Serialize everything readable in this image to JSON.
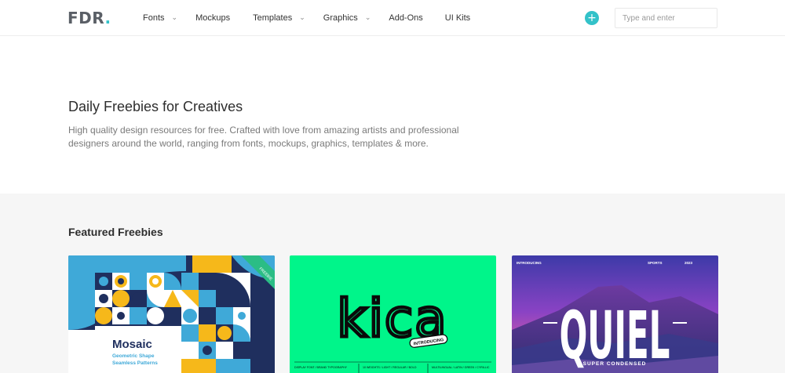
{
  "header": {
    "logo_text": "FDR",
    "logo_dot": ".",
    "nav": [
      {
        "label": "Fonts",
        "has_dropdown": true
      },
      {
        "label": "Mockups",
        "has_dropdown": false
      },
      {
        "label": "Templates",
        "has_dropdown": true
      },
      {
        "label": "Graphics",
        "has_dropdown": true
      },
      {
        "label": "Add-Ons",
        "has_dropdown": false
      },
      {
        "label": "UI Kits",
        "has_dropdown": false
      }
    ],
    "add_icon": "plus-icon",
    "add_symbol": "+",
    "search_placeholder": "Type and enter"
  },
  "hero": {
    "title": "Daily Freebies for Creatives",
    "description": "High quality design resources for free. Crafted with love from amazing artists and professional designers around the world, ranging from fonts, mockups, graphics, templates & more."
  },
  "featured": {
    "title": "Featured Freebies",
    "cards": [
      {
        "title": "Mosaic",
        "subtitle_line1": "Geometric Shape",
        "subtitle_line2": "Seamless Patterns",
        "ribbon": "FREEBIE"
      },
      {
        "title": "kica",
        "tag": "INTRODUCING",
        "footer_col1": "DISPLAY FONT / BRAND TYPOGRAPHY",
        "footer_col2": "10 WEIGHTS / LIGHT / REGULAR / BOLD",
        "footer_col3": "MULTILINGUAL / LATIN / GREEK / CYRILLIC"
      },
      {
        "title": "QUIEL",
        "subtitle": "SUPER CONDENSED",
        "intro": "INTRODUCING",
        "meta1": "SPORTS",
        "meta2": "2023"
      }
    ]
  },
  "colors": {
    "accent": "#33c2c9",
    "kica_bg": "#00f58a",
    "mosaic_navy": "#1f2f5e",
    "mosaic_yellow": "#f6b81a",
    "mosaic_blue": "#3fa9d8"
  }
}
